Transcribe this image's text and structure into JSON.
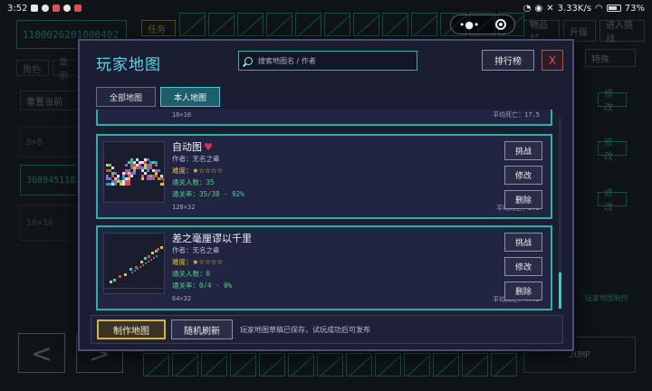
{
  "status": {
    "time": "3:52",
    "speed": "3.33K/s",
    "battery": "73%"
  },
  "background": {
    "code_top": "1180026201000402",
    "code_mid": "36894511825",
    "task_label": "任务",
    "role_label": "角色",
    "menu_label": "显示",
    "reset_label": "重置当前",
    "size_a": "8×8",
    "size_b": "16×16",
    "right_btn1": "物品栏",
    "right_btn2": "升级",
    "right_btn3": "进入挑战",
    "right_btn4": "特殊",
    "right_side1": "修改",
    "right_side2": "修改",
    "right_side3": "修改",
    "right_note": "玩家地图制作",
    "jump_label": "JUMP",
    "arrow_left": "<",
    "arrow_right": ">"
  },
  "modal": {
    "title": "玩家地图",
    "search_placeholder": "搜索地图名 / 作者",
    "rank_label": "排行榜",
    "close_label": "X",
    "tabs": [
      {
        "label": "全部地图",
        "active": false
      },
      {
        "label": "本人地图",
        "active": true
      }
    ],
    "partial_card": {
      "size": "16×16",
      "avg": "平均死亡：17.5"
    },
    "maps": [
      {
        "title": "自动图",
        "favorite": true,
        "author": "作者：无名之辈",
        "difficulty": "难度：★☆☆☆☆",
        "plays": "通关人数：35",
        "rate": "通关率：35/38 · 92%",
        "size": "128×32",
        "avg": "平均死亡：2.2",
        "actions": [
          "挑战",
          "修改",
          "删除"
        ]
      },
      {
        "title": "差之毫厘谬以千里",
        "favorite": false,
        "author": "作者：无名之辈",
        "difficulty": "难度：★☆☆☆☆",
        "plays": "通关人数：0",
        "rate": "通关率：0/4 · 0%",
        "size": "64×32",
        "avg": "平均死亡：47.5",
        "actions": [
          "挑战",
          "修改",
          "删除"
        ]
      }
    ],
    "bottom": {
      "make_label": "制作地图",
      "refresh_label": "随机刷新",
      "tip": "玩家地图草稿已保存，试玩成功后可发布"
    }
  },
  "capsule": {
    "menu_glyph": "•●•"
  }
}
